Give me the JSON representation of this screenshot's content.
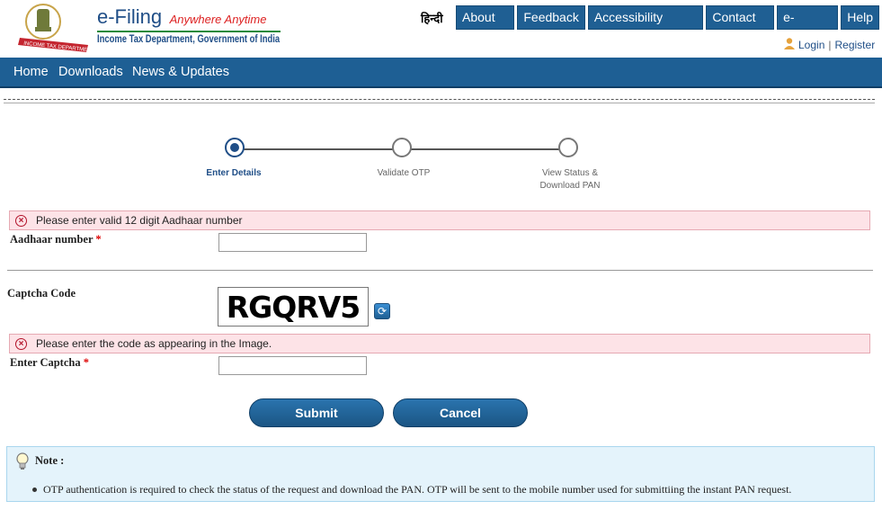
{
  "header": {
    "logo_text": "INCOME TAX DEPARTMENT",
    "brand_title": "e-Filing",
    "brand_tagline": "Anywhere Anytime",
    "brand_dept": "Income Tax Department, Government of India",
    "hindi_link": "हिन्दी",
    "top_nav": [
      "About Us",
      "Feedback",
      "Accessibility Options",
      "Contact Us",
      "e-Nivaran",
      "Help"
    ],
    "login_label": "Login",
    "separator": "|",
    "register_label": "Register"
  },
  "main_nav": [
    "Home",
    "Downloads",
    "News & Updates"
  ],
  "steps": [
    {
      "label": "Enter Details",
      "active": true
    },
    {
      "label": "Validate OTP",
      "active": false
    },
    {
      "label_line1": "View Status &",
      "label_line2": "Download PAN",
      "active": false
    }
  ],
  "form": {
    "aadhaar_error": "Please enter valid 12 digit Aadhaar number",
    "aadhaar_label": "Aadhaar number",
    "required_mark": "*",
    "aadhaar_value": "",
    "captcha_label": "Captcha Code",
    "captcha_text": "RGQRV5",
    "captcha_error": "Please enter the code as appearing in the Image.",
    "enter_captcha_label": "Enter Captcha",
    "enter_captcha_value": "",
    "submit_label": "Submit",
    "cancel_label": "Cancel"
  },
  "note": {
    "title": "Note :",
    "text": "OTP authentication is required to check the status of the request and download the PAN. OTP will be sent to the mobile number used for submittiing the instant PAN request."
  },
  "colors": {
    "primary": "#1f5f93",
    "error_bg": "#fde3e7",
    "note_bg": "#e4f3fb"
  },
  "icons": [
    "emblem-logo",
    "user-icon",
    "error-icon",
    "refresh-icon",
    "bulb-icon"
  ]
}
